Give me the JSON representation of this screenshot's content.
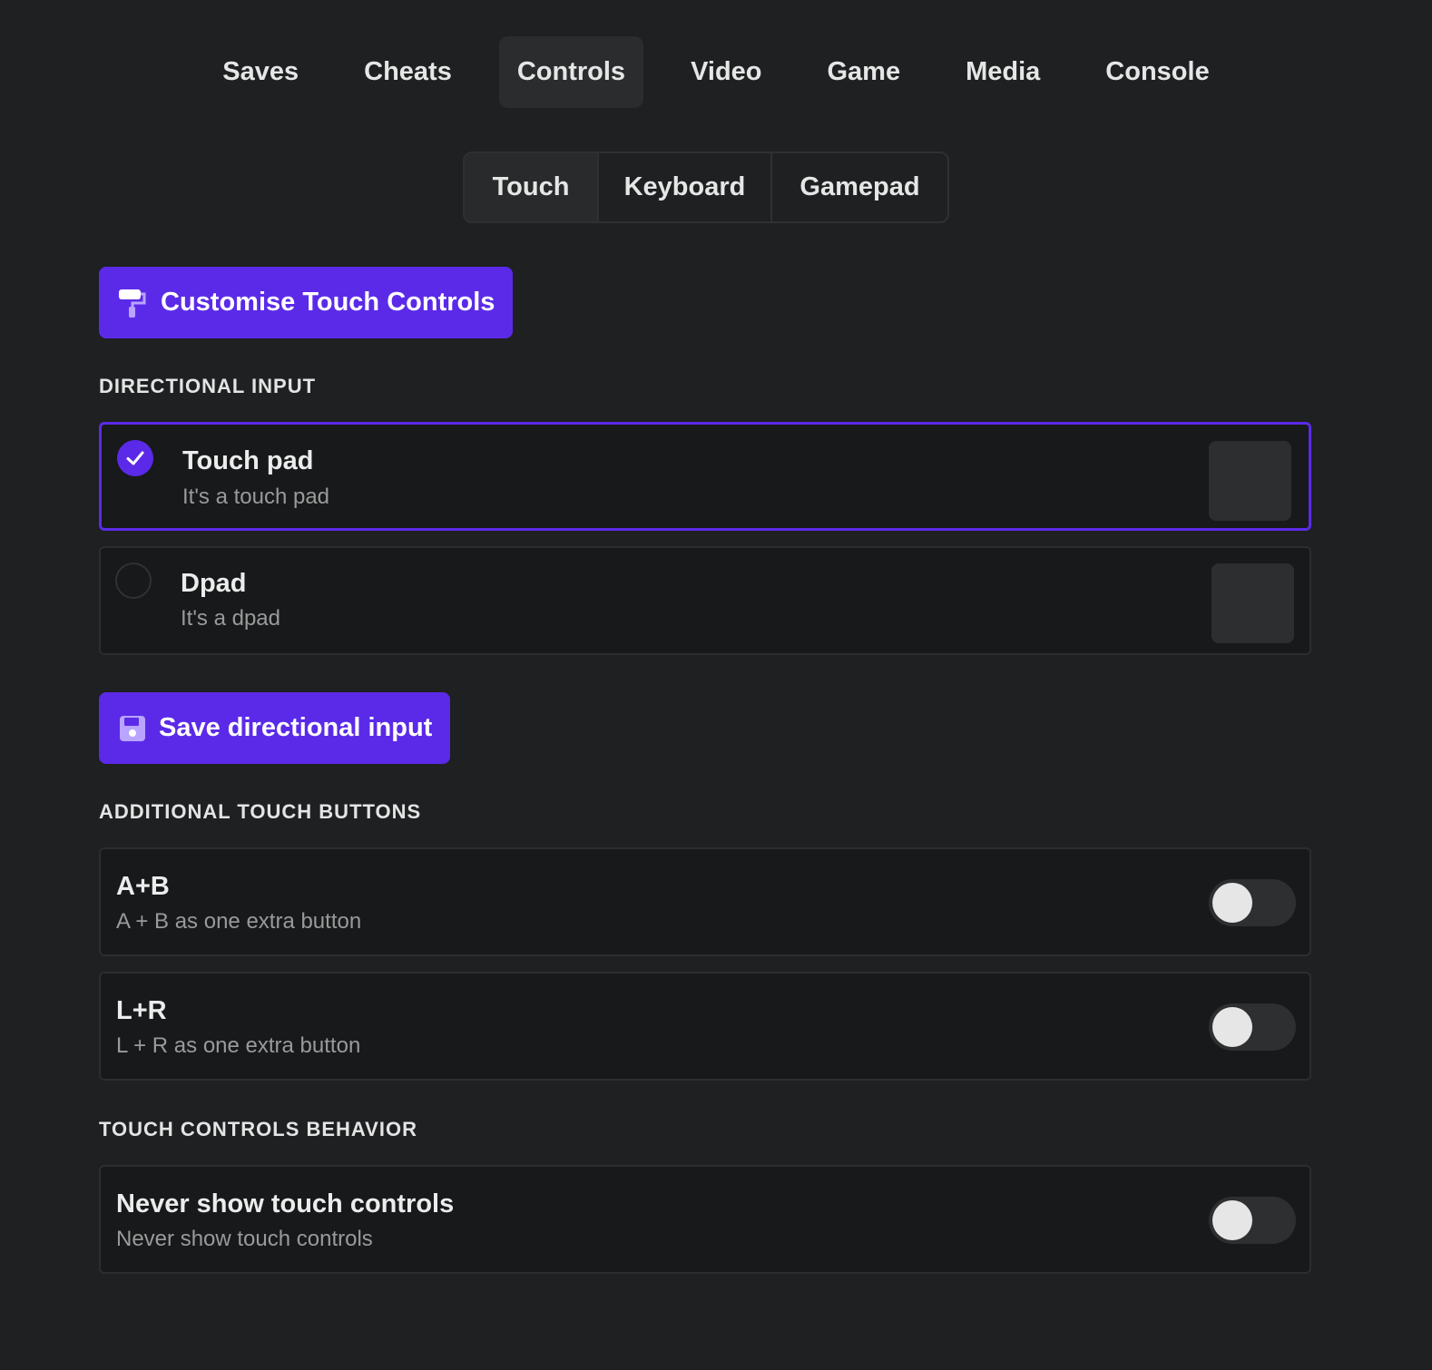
{
  "top_nav": {
    "tabs": [
      {
        "label": "Saves",
        "active": false
      },
      {
        "label": "Cheats",
        "active": false
      },
      {
        "label": "Controls",
        "active": true
      },
      {
        "label": "Video",
        "active": false
      },
      {
        "label": "Game",
        "active": false
      },
      {
        "label": "Media",
        "active": false
      },
      {
        "label": "Console",
        "active": false
      }
    ]
  },
  "sub_tabs": {
    "tabs": [
      {
        "label": "Touch",
        "active": true
      },
      {
        "label": "Keyboard",
        "active": false
      },
      {
        "label": "Gamepad",
        "active": false
      }
    ]
  },
  "customise_button": {
    "label": "Customise Touch Controls",
    "icon": "paint-roller-icon"
  },
  "directional_input": {
    "heading": "DIRECTIONAL INPUT",
    "options": [
      {
        "title": "Touch pad",
        "description": "It's a touch pad",
        "selected": true
      },
      {
        "title": "Dpad",
        "description": "It's a dpad",
        "selected": false
      }
    ],
    "save_button": {
      "label": "Save directional input",
      "icon": "floppy-disk-icon"
    }
  },
  "additional_buttons": {
    "heading": "ADDITIONAL TOUCH BUTTONS",
    "items": [
      {
        "title": "A+B",
        "description": "A + B as one extra button",
        "enabled": false
      },
      {
        "title": "L+R",
        "description": "L + R as one extra button",
        "enabled": false
      }
    ]
  },
  "behavior": {
    "heading": "TOUCH CONTROLS BEHAVIOR",
    "items": [
      {
        "title": "Never show touch controls",
        "description": "Never show touch controls",
        "enabled": false
      }
    ]
  },
  "colors": {
    "background": "#1e2021",
    "accent": "#5b2ae8",
    "card": "#17191a"
  }
}
